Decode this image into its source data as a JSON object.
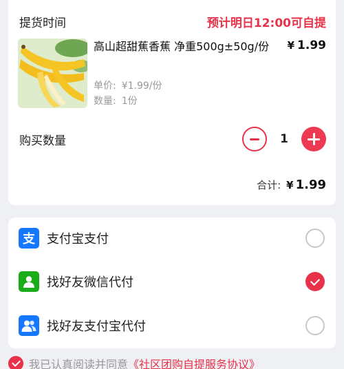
{
  "pickup": {
    "label": "提货时间",
    "value": "预计明日12:00可自提"
  },
  "product": {
    "name": "高山超甜蕉香蕉 净重500g±50g/份",
    "price_symbol": "¥",
    "price": "1.99",
    "unit_label": "单价:",
    "unit_price": "¥1.99/份",
    "qty_label": "数量:",
    "qty_value": "1份",
    "image_icon": "banana-image"
  },
  "quantity": {
    "label": "购买数量",
    "value": "1"
  },
  "total": {
    "label": "合计:",
    "symbol": "¥",
    "amount": "1.99"
  },
  "payment": {
    "options": [
      {
        "label": "支付宝支付",
        "icon": "alipay-icon",
        "icon_char": "支",
        "color": "#1677ff",
        "selected": false
      },
      {
        "label": "找好友微信代付",
        "icon": "wechat-friend-icon",
        "color": "#1aad19",
        "selected": true
      },
      {
        "label": "找好友支付宝代付",
        "icon": "alipay-friend-icon",
        "color": "#1677ff",
        "selected": false
      }
    ]
  },
  "agreement": {
    "text": "我已认真阅读并同意",
    "link": "《社区团购自提服务协议》"
  },
  "colors": {
    "accent": "#e8324a",
    "alipay": "#1677ff",
    "wechat": "#1aad19"
  }
}
